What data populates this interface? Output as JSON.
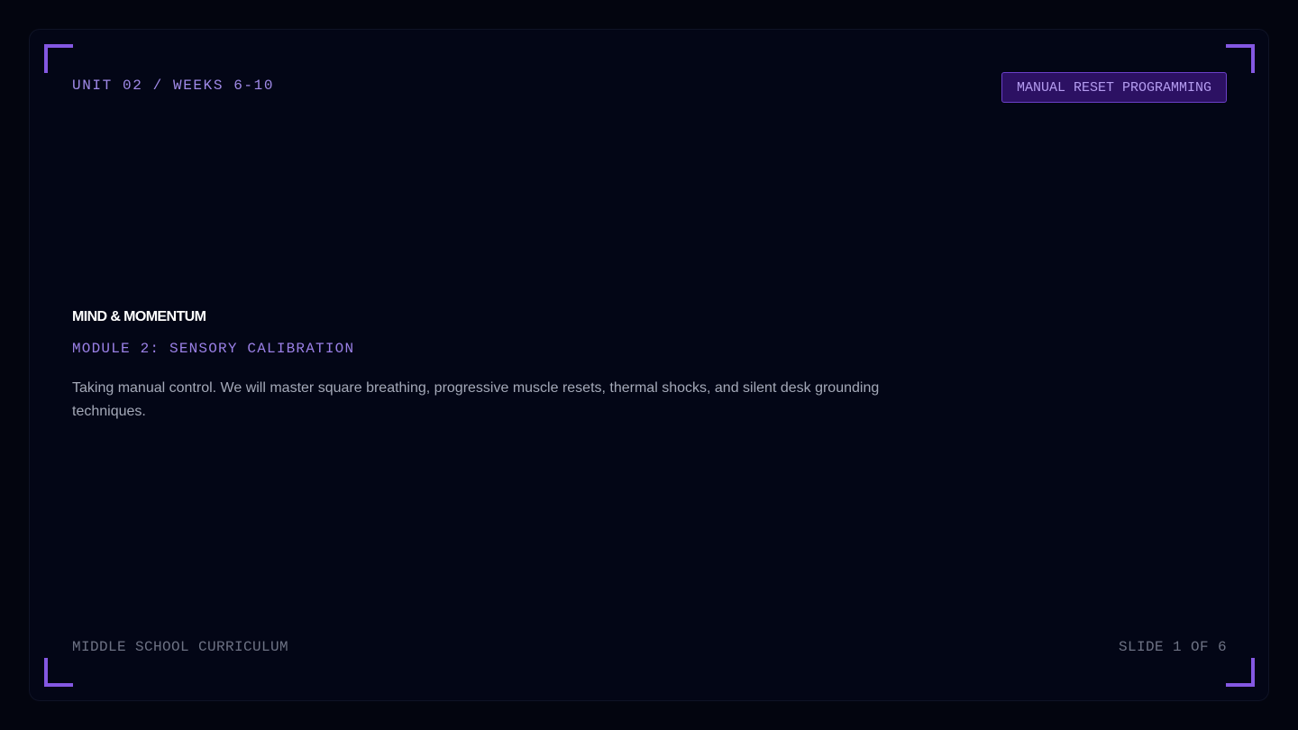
{
  "header": {
    "unit_label": "UNIT 02 / WEEKS 6-10",
    "tag_label": "MANUAL RESET PROGRAMMING"
  },
  "main": {
    "brand_title": "MIND & MOMENTUM",
    "module_title": "MODULE 2: SENSORY CALIBRATION",
    "description": "Taking manual control. We will master square breathing, progressive muscle resets, thermal shocks, and silent desk grounding techniques."
  },
  "footer": {
    "curriculum_label": "MIDDLE SCHOOL CURRICULUM",
    "slide_counter": "SLIDE 1 OF 6"
  },
  "colors": {
    "background": "#03050f",
    "accent": "#8458e2",
    "accent_text": "#a08ae8",
    "tag_background": "#2c1163",
    "title_text": "#ffffff",
    "body_text": "#a4a9b8",
    "muted_text": "#6d7284"
  }
}
